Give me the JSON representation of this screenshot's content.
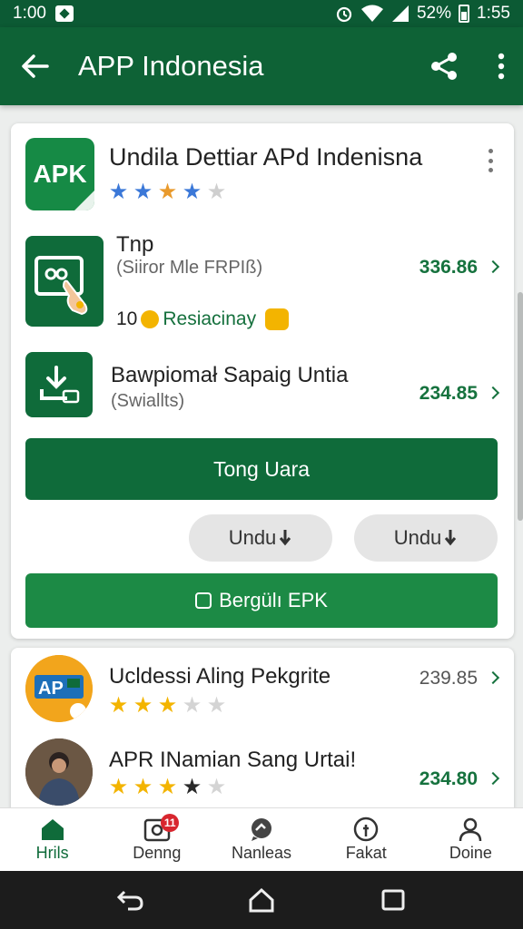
{
  "status_bar": {
    "time_left": "1:00",
    "battery": "52%",
    "time_right": "1:55"
  },
  "app_bar": {
    "title": "APP Indonesia"
  },
  "card_main": {
    "logo_text": "APK",
    "title": "Undila Dettiar APd  Indenisna",
    "rating_stars": 4,
    "star_colors": [
      "#3b78d8",
      "#3b78d8",
      "#e99a2c",
      "#3b78d8",
      "#cfcfcf"
    ],
    "rows": [
      {
        "title": "Tnp",
        "subtitle": "(Siiror Mle FRPIß)",
        "price": "336.86",
        "icon": "card-touch-icon"
      },
      {
        "title": "Bawpiomał Sapaig Untia",
        "subtitle": "(Swiallts)",
        "price": "234.85",
        "icon": "download-tray-icon"
      }
    ],
    "promo": {
      "count": "10",
      "label": "Resiacinay"
    },
    "primary_button": "Tong Uara",
    "pill_buttons": [
      "Undu",
      "Undu"
    ],
    "green_button": "Bergülı EPK"
  },
  "card_list": {
    "items": [
      {
        "title": "Ucldessi Aling Pekgrite",
        "price": "239.85",
        "rating_stars": 3,
        "avatar_text": "AP",
        "price_style": "muted"
      },
      {
        "title": "APR INamian Sang Urtai!",
        "price": "234.80",
        "rating_stars": 3.5,
        "price_style": "green"
      }
    ]
  },
  "bottom_nav": {
    "items": [
      {
        "label": "Hrils",
        "icon": "home-icon",
        "active": true
      },
      {
        "label": "Denng",
        "icon": "camera-icon",
        "badge": "11"
      },
      {
        "label": "Nanleas",
        "icon": "chat-icon"
      },
      {
        "label": "Fakat",
        "icon": "info-icon"
      },
      {
        "label": "Doine",
        "icon": "person-icon"
      }
    ]
  },
  "colors": {
    "primary": "#0e6236",
    "accent": "#1c8a45",
    "price": "#16723e",
    "star_gold": "#f3b400"
  }
}
